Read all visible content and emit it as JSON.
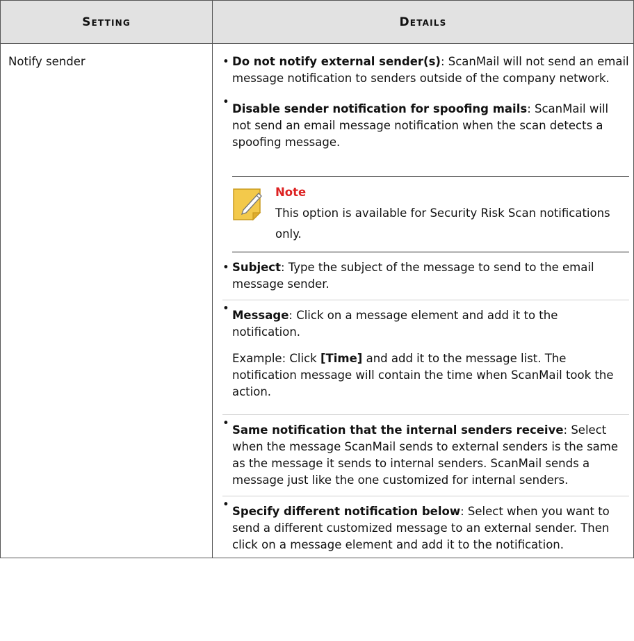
{
  "table": {
    "headers": [
      "Setting",
      "Details"
    ],
    "setting": "Notify sender",
    "items_top": [
      {
        "bold": "Do not notify external sender(s)",
        "rest": ": ScanMail will not send an email message notification to senders outside of the company network."
      },
      {
        "bold": "Disable sender notification for spoofing mails",
        "rest": ": ScanMail will not send an email message notification when the scan detects a spoofing message."
      }
    ],
    "note": {
      "title": "Note",
      "text": "This option is available for Security Risk Scan notifications only."
    },
    "items_bottom": [
      {
        "bold": "Subject",
        "rest": ": Type the subject of the message to send to the email message sender."
      },
      {
        "bold": "Message",
        "rest": ": Click on a message element and add it to the notification."
      }
    ],
    "example": {
      "pre": "Example: Click ",
      "bold": "[Time]",
      "post": " and add it to the message list. The notification message will contain the time when ScanMail took the action."
    },
    "items_last": [
      {
        "bold": "Same notification that the internal senders receive",
        "rest": ": Select when the message ScanMail sends to external senders is the same as the message it sends to internal senders. ScanMail sends a message just like the one customized for internal senders."
      },
      {
        "bold": "Specify different notification below",
        "rest": ": Select when you want to send a different customized message to an external sender. Then click on a message element and add it to the notification."
      }
    ],
    "colors": {
      "header_bg": "#e2e2e2",
      "note_title": "#dd2222",
      "note_icon": "#f3c94b"
    },
    "icons": {
      "note": "note-pencil-icon"
    }
  }
}
